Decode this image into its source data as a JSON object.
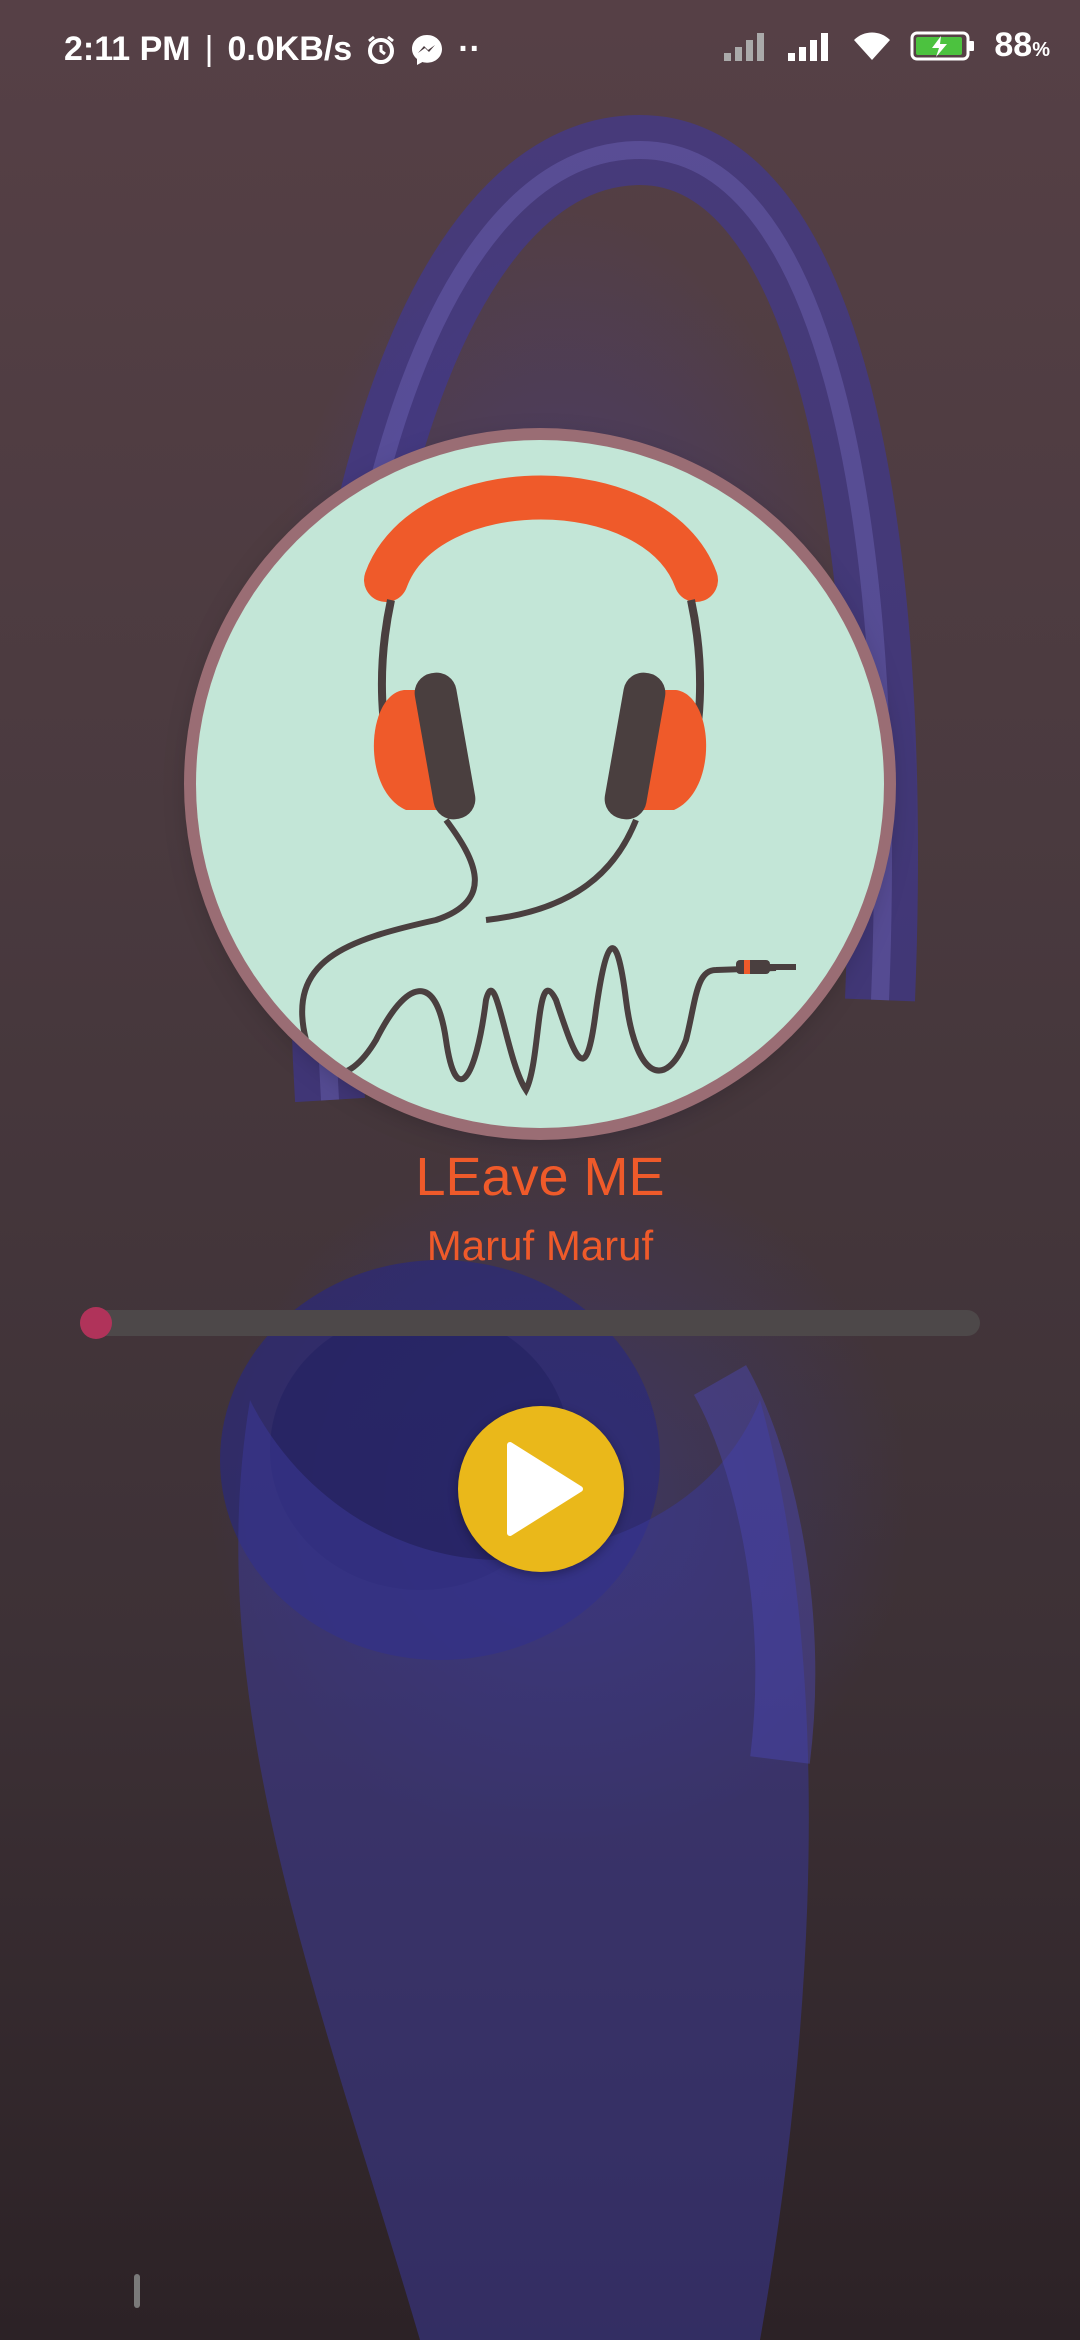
{
  "status_bar": {
    "time": "2:11 PM",
    "separator": "|",
    "network_speed": "0.0KB/s",
    "overflow_dots": "··",
    "battery_percent": "88",
    "battery_unit": "%",
    "icons": [
      "alarm-icon",
      "messenger-icon",
      "signal-icon",
      "signal-icon",
      "wifi-icon",
      "battery-charging-icon"
    ]
  },
  "player": {
    "album_art": "headphones-illustration",
    "title": "LEave ME",
    "artist": "Maruf Maruf",
    "progress_fraction": 0.0,
    "play_icon": "play-icon"
  },
  "colors": {
    "accent_text": "#ef5a2a",
    "seek_active": "#b0335a",
    "play_button": "#eab81a",
    "album_bg": "#c3e6d7"
  }
}
